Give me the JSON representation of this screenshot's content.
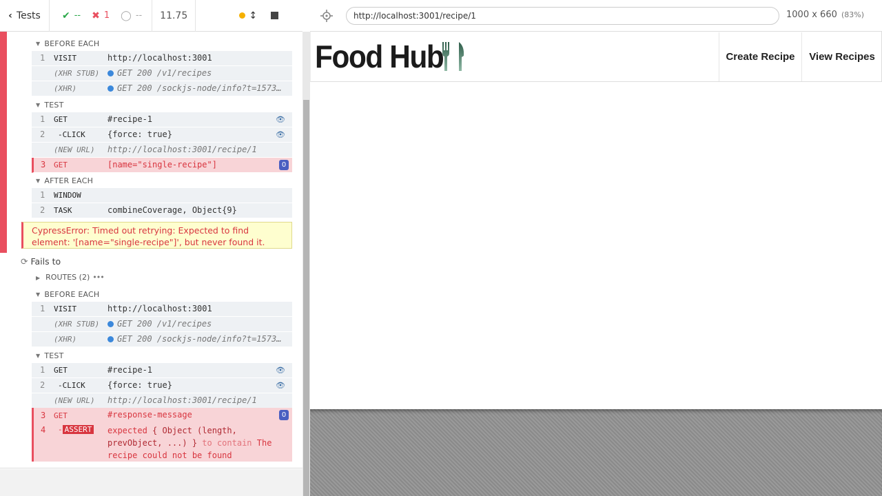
{
  "header": {
    "tests_label": "Tests",
    "passed": "--",
    "failed": "1",
    "pending": "--",
    "duration": "11.75"
  },
  "colors": {
    "fail": "#e94f5f",
    "pass": "#2ba84a",
    "badge": "#4a5fc1",
    "error_bg": "#fefecf"
  },
  "attempt1": {
    "before_each": {
      "title": "BEFORE EACH",
      "commands": [
        {
          "num": "1",
          "name": "VISIT",
          "msg": "http://localhost:3001"
        },
        {
          "num": "",
          "name": "(XHR STUB)",
          "msg": "GET 200 /v1/recipes"
        },
        {
          "num": "",
          "name": "(XHR)",
          "msg": "GET 200 /sockjs-node/info?t=15736..."
        }
      ]
    },
    "test": {
      "title": "TEST",
      "commands": [
        {
          "num": "1",
          "name": "GET",
          "msg": "#recipe-1"
        },
        {
          "num": "2",
          "name": "-CLICK",
          "msg": "{force: true}"
        },
        {
          "num": "",
          "name": "(NEW URL)",
          "msg": "http://localhost:3001/recipe/1"
        },
        {
          "num": "3",
          "name": "GET",
          "msg": "[name=\"single-recipe\"]",
          "badge": "0"
        }
      ]
    },
    "after_each": {
      "title": "AFTER EACH",
      "commands": [
        {
          "num": "1",
          "name": "WINDOW",
          "msg": ""
        },
        {
          "num": "2",
          "name": "TASK",
          "msg": "combineCoverage, Object{9}"
        }
      ]
    },
    "error": "CypressError: Timed out retrying: Expected to find element: '[name=\"single-recipe\"]', but never found it."
  },
  "fails_to": {
    "label": "Fails to",
    "routes_label": "ROUTES (2)",
    "before_each": {
      "title": "BEFORE EACH",
      "commands": [
        {
          "num": "1",
          "name": "VISIT",
          "msg": "http://localhost:3001"
        },
        {
          "num": "",
          "name": "(XHR STUB)",
          "msg": "GET 200 /v1/recipes"
        },
        {
          "num": "",
          "name": "(XHR)",
          "msg": "GET 200 /sockjs-node/info?t=15736..."
        }
      ]
    },
    "test": {
      "title": "TEST",
      "commands": [
        {
          "num": "1",
          "name": "GET",
          "msg": "#recipe-1"
        },
        {
          "num": "2",
          "name": "-CLICK",
          "msg": "{force: true}"
        },
        {
          "num": "",
          "name": "(NEW URL)",
          "msg": "http://localhost:3001/recipe/1"
        },
        {
          "num": "3",
          "name": "GET",
          "msg": "#response-message",
          "badge": "0"
        }
      ]
    },
    "assert": {
      "num": "4",
      "name": "ASSERT",
      "expected_word": "expected",
      "subject": "{ Object (length,",
      "subject2": "prevObject, ...) }",
      "to_contain": "to contain",
      "value1": "The",
      "value2": "recipe could not be found"
    }
  },
  "aut": {
    "url": "http://localhost:3001/recipe/1",
    "viewport": "1000 x 660",
    "scale": "(83%)",
    "site": {
      "logo_text": "Food Hub",
      "nav": [
        "Create Recipe",
        "View Recipes"
      ]
    }
  }
}
